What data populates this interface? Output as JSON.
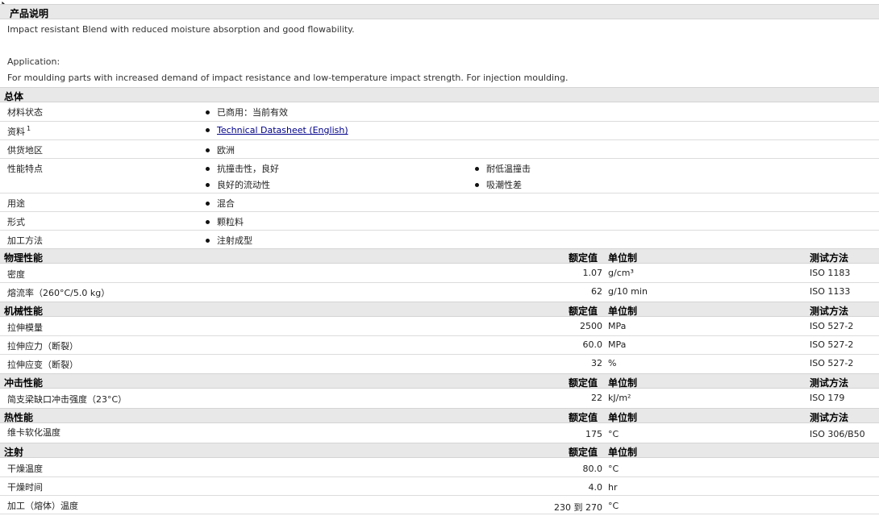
{
  "intro": {
    "header": "产品说明",
    "description": "Impact resistant Blend with reduced moisture absorption and good flowability.",
    "application_label": "Application:",
    "application_text": "For moulding parts with increased demand of impact resistance and low-temperature impact strength. For injection moulding."
  },
  "general": {
    "header": "总体",
    "rows": {
      "status": {
        "label": "材料状态",
        "value": "已商用：当前有效"
      },
      "documents": {
        "label": "资料",
        "sup": "1",
        "value": "Technical Datasheet (English)"
      },
      "region": {
        "label": "供货地区",
        "value": "欧洲"
      },
      "features": {
        "label": "性能特点",
        "v1": "抗撞击性，良好",
        "v2": "耐低温撞击",
        "v3": "良好的流动性",
        "v4": "吸潮性差"
      },
      "uses": {
        "label": "用途",
        "value": "混合"
      },
      "form": {
        "label": "形式",
        "value": "颗粒料"
      },
      "processing": {
        "label": "加工方法",
        "value": "注射成型"
      }
    }
  },
  "columns": {
    "nominal": "额定值",
    "unit": "单位制",
    "method": "测试方法"
  },
  "physical": {
    "header": "物理性能",
    "density": {
      "label": "密度",
      "value": "1.07",
      "unit": "g/cm³",
      "method": "ISO 1183"
    },
    "mfr": {
      "label": "熔流率（260°C/5.0 kg）",
      "value": "62",
      "unit": "g/10 min",
      "method": "ISO 1133"
    }
  },
  "mechanical": {
    "header": "机械性能",
    "modulus": {
      "label": "拉伸模量",
      "value": "2500",
      "unit": "MPa",
      "method": "ISO 527-2"
    },
    "stress": {
      "label": "拉伸应力（断裂）",
      "value": "60.0",
      "unit": "MPa",
      "method": "ISO 527-2"
    },
    "strain": {
      "label": "拉伸应变（断裂）",
      "value": "32",
      "unit": "%",
      "method": "ISO 527-2"
    }
  },
  "impact": {
    "header": "冲击性能",
    "charpy": {
      "label": "简支梁缺口冲击强度（23°C）",
      "value": "22",
      "unit": "kJ/m²",
      "method": "ISO 179"
    }
  },
  "thermal": {
    "header": "热性能",
    "vicat": {
      "label": "维卡软化温度",
      "value": "175",
      "unit": "°C",
      "method": "ISO 306/B50"
    }
  },
  "injection": {
    "header": "注射",
    "dry_temp": {
      "label": "干燥温度",
      "value": "80.0",
      "unit": "°C"
    },
    "dry_time": {
      "label": "干燥时间",
      "value": "4.0",
      "unit": "hr"
    },
    "melt_temp": {
      "label": "加工（熔体）温度",
      "value": "230 到 270",
      "unit": "°C"
    }
  }
}
